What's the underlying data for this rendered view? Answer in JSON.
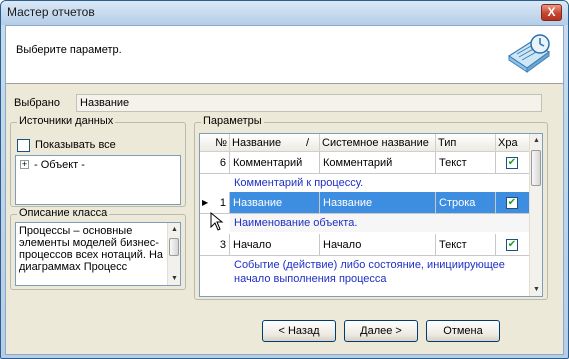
{
  "window": {
    "title": "Мастер отчетов",
    "close_label": "X"
  },
  "header": {
    "text": "Выберите параметр."
  },
  "selected": {
    "label": "Выбрано",
    "value": "Название"
  },
  "sources": {
    "legend": "Источники данных",
    "show_all_label": "Показывать все",
    "tree_expander": "+",
    "tree_item": "- Объект -"
  },
  "class_desc": {
    "legend": "Описание класса",
    "text": "Процессы – основные элементы моделей бизнес-процессов всех нотаций. На диаграммах Процесс"
  },
  "params": {
    "legend": "Параметры",
    "columns": {
      "num": "№",
      "name": "Название",
      "sort": "/",
      "system": "Системное название",
      "type": "Тип",
      "store": "Хра"
    },
    "rows": [
      {
        "num": "6",
        "name": "Комментарий",
        "system": "Комментарий",
        "type": "Текст",
        "checked": true,
        "desc": "Комментарий к процессу."
      },
      {
        "num": "1",
        "name": "Название",
        "system": "Название",
        "type": "Строка",
        "checked": true,
        "desc": "Наименование объекта."
      },
      {
        "num": "3",
        "name": "Начало",
        "system": "Начало",
        "type": "Текст",
        "checked": true,
        "desc": "Событие (действие) либо состояние, инициирующее",
        "desc2": "начало выполнения процесса"
      }
    ],
    "check_mark": "✔",
    "row_pointer": "▶"
  },
  "buttons": {
    "back": "< Назад",
    "next": "Далее >",
    "cancel": "Отмена"
  }
}
